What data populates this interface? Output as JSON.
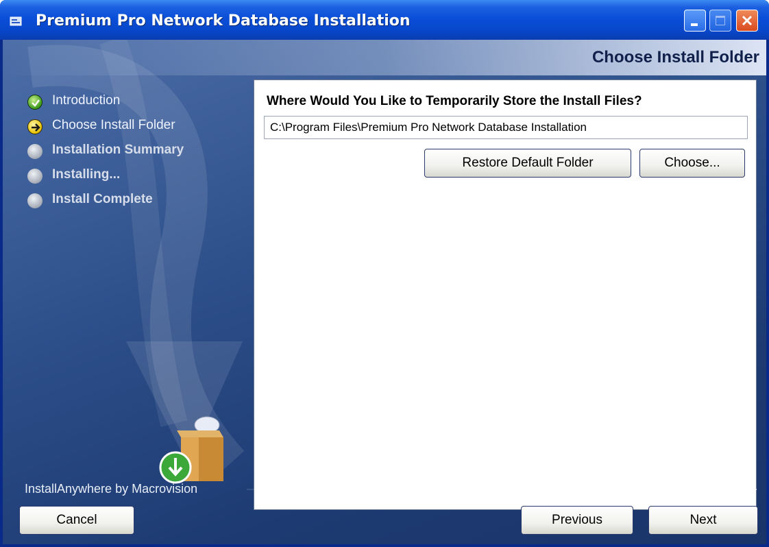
{
  "window": {
    "title": "Premium Pro Network Database Installation"
  },
  "header": {
    "heading": "Choose Install Folder"
  },
  "steps": [
    {
      "label": "Introduction",
      "state": "done",
      "icon": "check-icon"
    },
    {
      "label": "Choose Install Folder",
      "state": "current",
      "icon": "arrow-right-icon"
    },
    {
      "label": "Installation Summary",
      "state": "pending",
      "icon": "bullet-icon"
    },
    {
      "label": "Installing...",
      "state": "pending",
      "icon": "bullet-icon"
    },
    {
      "label": "Install Complete",
      "state": "pending",
      "icon": "bullet-icon"
    }
  ],
  "main": {
    "question": "Where Would You Like to Temporarily Store the Install Files?",
    "path_value": "C:\\Program Files\\Premium Pro Network Database Installation",
    "restore_label": "Restore Default Folder",
    "choose_label": "Choose..."
  },
  "footer": {
    "brand": "InstallAnywhere by Macrovision",
    "cancel_label": "Cancel",
    "previous_label": "Previous",
    "next_label": "Next"
  },
  "colors": {
    "title_bar": "#0a4fd8",
    "side_panel": "#2d4f8a",
    "close_button": "#d84a20"
  }
}
